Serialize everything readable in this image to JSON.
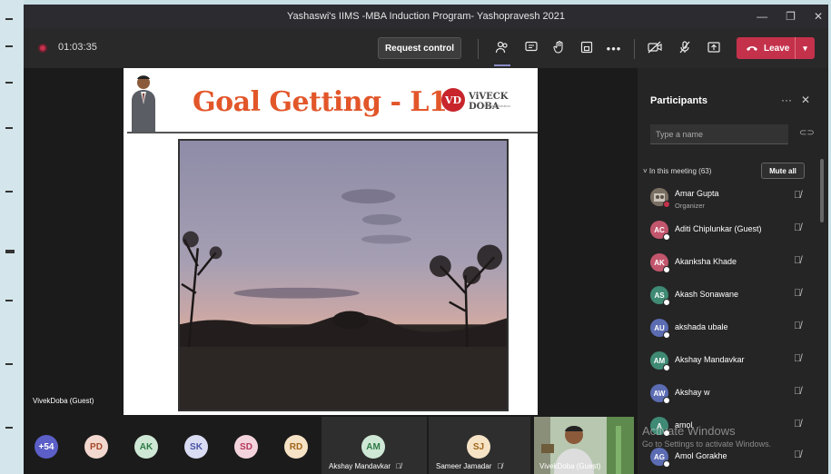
{
  "window": {
    "title": "Yashaswi's IIMS -MBA Induction Program- Yashopravesh 2021",
    "controls": [
      "—",
      "❐",
      "✕"
    ]
  },
  "toolbar": {
    "timer": "01:03:35",
    "request_control_label": "Request control",
    "leave_label": "Leave"
  },
  "stage": {
    "slide_title": "Goal Getting - L1",
    "logo_initials": "VD",
    "logo_name": "ViVECK DOBA",
    "logo_tagline": "Training Solution",
    "presenter_name": "VivekDoba (Guest)"
  },
  "bottom_strip": {
    "overflow_count": "+54",
    "avatars": [
      {
        "initials": "PD",
        "bg": "#f3d8cf",
        "fg": "#a44a2a"
      },
      {
        "initials": "AK",
        "bg": "#cfe8d6",
        "fg": "#2f7a45"
      },
      {
        "initials": "SK",
        "bg": "#d9dcf2",
        "fg": "#4a55a6"
      },
      {
        "initials": "SD",
        "bg": "#f4d4dc",
        "fg": "#b33a5c"
      },
      {
        "initials": "RD",
        "bg": "#f6e3c6",
        "fg": "#a0661b"
      }
    ],
    "tiles": [
      {
        "initials": "AM",
        "name": "Akshay Mandavkar",
        "bg": "#cfe8d6",
        "fg": "#2f7a45"
      },
      {
        "initials": "SJ",
        "name": "Sameer Jamadar",
        "bg": "#f6e3c6",
        "fg": "#a0661b"
      }
    ],
    "video_name": "VivekDoba (Guest)"
  },
  "participants": {
    "title": "Participants",
    "search_placeholder": "Type a name",
    "section_label": "In this meeting (63)",
    "mute_all_label": "Mute all",
    "list": [
      {
        "initials": "",
        "name": "Amar Gupta",
        "role": "Organizer",
        "color": "#7a6f63"
      },
      {
        "initials": "AC",
        "name": "Aditi Chiplunkar (Guest)",
        "role": "",
        "color": "#c2566d"
      },
      {
        "initials": "AK",
        "name": "Akanksha Khade",
        "role": "",
        "color": "#c2566d"
      },
      {
        "initials": "AS",
        "name": "Akash Sonawane",
        "role": "",
        "color": "#3f8a74"
      },
      {
        "initials": "AU",
        "name": "akshada ubale",
        "role": "",
        "color": "#5b6cb3"
      },
      {
        "initials": "AM",
        "name": "Akshay Mandavkar",
        "role": "",
        "color": "#3f8a74"
      },
      {
        "initials": "AW",
        "name": "Akshay w",
        "role": "",
        "color": "#5b6cb3"
      },
      {
        "initials": "A",
        "name": "amol",
        "role": "",
        "color": "#3f8a74"
      },
      {
        "initials": "AG",
        "name": "Amol Gorakhe",
        "role": "",
        "color": "#5b6cb3"
      }
    ]
  },
  "watermark": {
    "line1": "Activate Windows",
    "line2": "Go to Settings to activate Windows."
  }
}
